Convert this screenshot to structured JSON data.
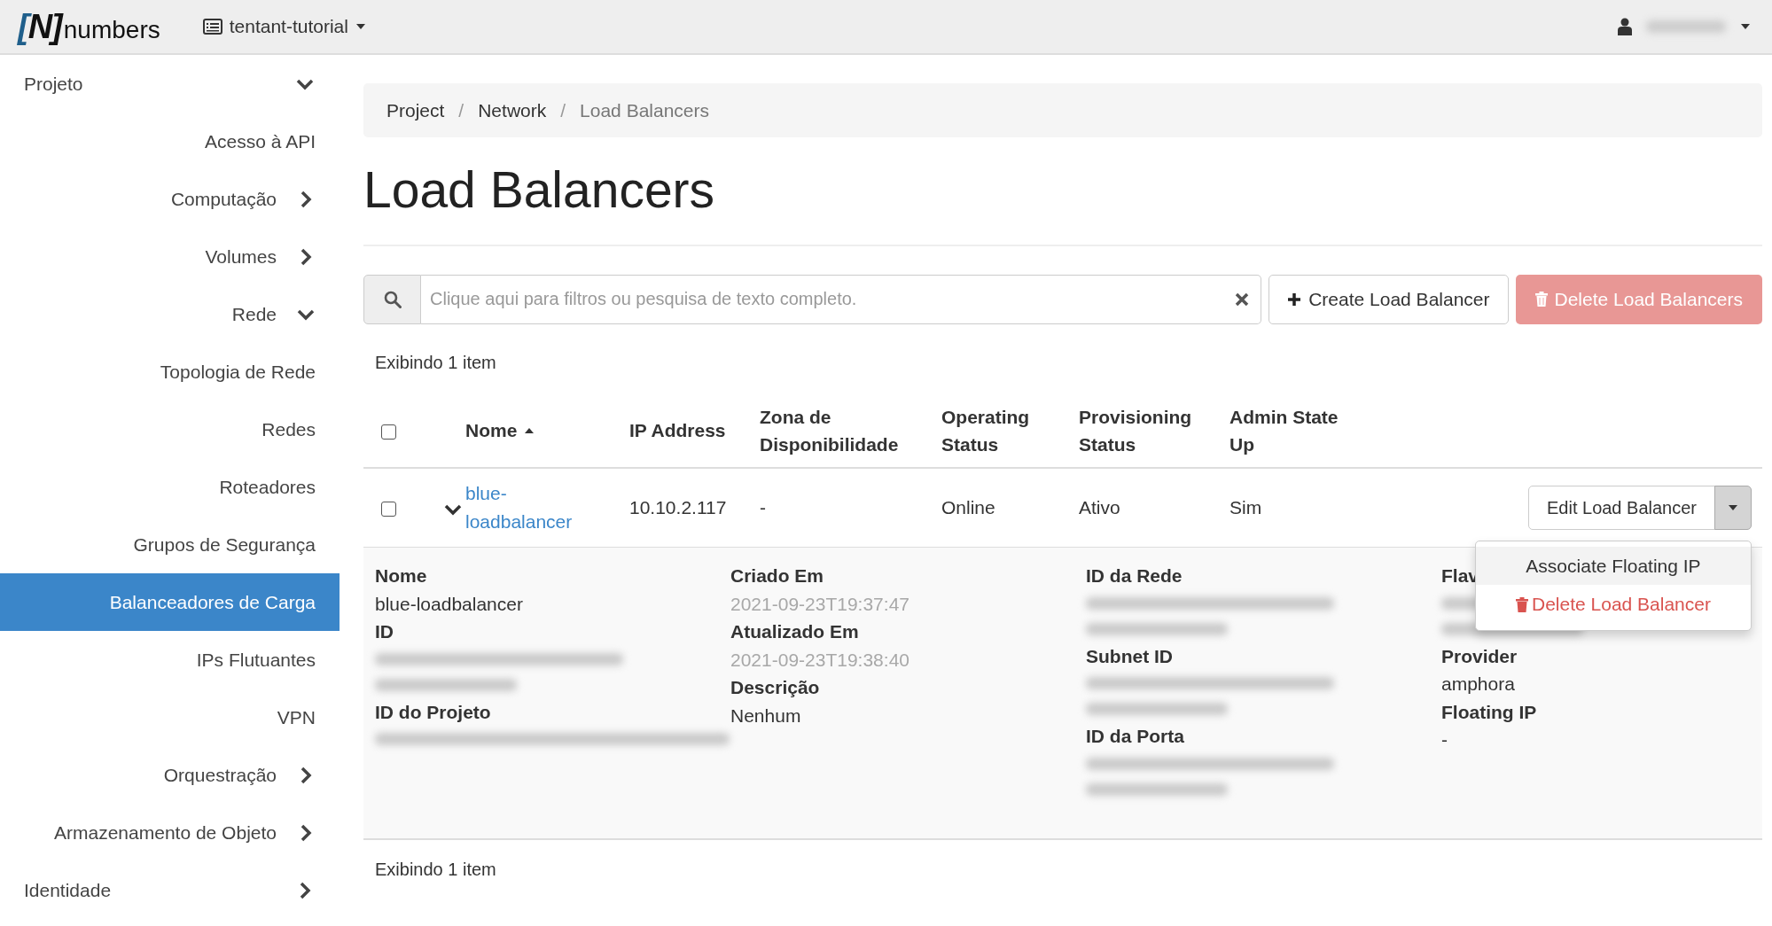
{
  "navbar": {
    "logo": {
      "mark": "[N]",
      "name": "numbers"
    },
    "project_menu": {
      "label": "tentant-tutorial"
    },
    "user_menu": {
      "name_redacted": true
    }
  },
  "sidebar": {
    "items": [
      {
        "kind": "group",
        "label": "Projeto",
        "expanded": true,
        "selected": false,
        "children": [
          {
            "kind": "link",
            "label": "Acesso à API",
            "selected": false
          },
          {
            "kind": "group",
            "label": "Computação",
            "expanded": false,
            "selected": false
          },
          {
            "kind": "group",
            "label": "Volumes",
            "expanded": false,
            "selected": false
          },
          {
            "kind": "group",
            "label": "Rede",
            "expanded": true,
            "selected": false,
            "children": [
              {
                "kind": "link",
                "label": "Topologia de Rede",
                "selected": false
              },
              {
                "kind": "link",
                "label": "Redes",
                "selected": false
              },
              {
                "kind": "link",
                "label": "Roteadores",
                "selected": false
              },
              {
                "kind": "link",
                "label": "Grupos de Segurança",
                "selected": false
              },
              {
                "kind": "link",
                "label": "Balanceadores de Carga",
                "selected": true
              },
              {
                "kind": "link",
                "label": "IPs Flutuantes",
                "selected": false
              },
              {
                "kind": "link",
                "label": "VPN",
                "selected": false
              }
            ]
          },
          {
            "kind": "group",
            "label": "Orquestração",
            "expanded": false,
            "selected": false
          },
          {
            "kind": "group",
            "label": "Armazenamento de Objeto",
            "expanded": false,
            "selected": false
          }
        ]
      },
      {
        "kind": "group",
        "label": "Identidade",
        "expanded": false,
        "selected": false
      }
    ]
  },
  "breadcrumb": {
    "items": [
      "Project",
      "Network",
      "Load Balancers"
    ],
    "separators": [
      "/",
      "/"
    ]
  },
  "page_title": "Load Balancers",
  "toolbar": {
    "search": {
      "placeholder": "Clique aqui para filtros ou pesquisa de texto completo."
    },
    "buttons": [
      {
        "kind": "create",
        "label": "Create Load Balancer",
        "disabled": false
      },
      {
        "kind": "delete",
        "label": "Delete Load Balancers",
        "disabled": true
      }
    ]
  },
  "table": {
    "count_top": "Exibindo 1 item",
    "select_all_checked": false,
    "columns": [
      {
        "label": "Nome",
        "sorted": true
      },
      {
        "label": "IP Address",
        "sorted": false
      },
      {
        "label": "Zona de Disponibilidade",
        "sorted": false
      },
      {
        "label": "Operating Status",
        "sorted": false
      },
      {
        "label": "Provisioning Status",
        "sorted": false
      },
      {
        "label": "Admin State Up",
        "sorted": false
      }
    ],
    "rows": [
      {
        "checked": false,
        "expanded": true,
        "cells": [
          "blue-loadbalancer",
          "10.10.2.117",
          "-",
          "Online",
          "Ativo",
          "Sim"
        ],
        "actions": {
          "primary": "Edit Load Balancer",
          "menu_open": true,
          "menu": [
            {
              "kind": "normal",
              "label": "Associate Floating IP",
              "selected": true
            },
            {
              "kind": "danger",
              "label": "Delete Load Balancer",
              "selected": false
            }
          ]
        },
        "details": [
          [
            {
              "label": "Nome",
              "value": "blue-loadbalancer"
            },
            {
              "label": "ID",
              "redacted": true,
              "wrapped": true
            },
            {
              "label": "ID do Projeto",
              "redacted": true,
              "wrapped": false
            }
          ],
          [
            {
              "label": "Criado Em",
              "value": "2021-09-23T19:37:47",
              "faded": true
            },
            {
              "label": "Atualizado Em",
              "value": "2021-09-23T19:38:40",
              "faded": true
            },
            {
              "label": "Descrição",
              "value": "Nenhum"
            }
          ],
          [
            {
              "label": "ID da Rede",
              "redacted": true,
              "wrapped": true
            },
            {
              "label": "Subnet ID",
              "redacted": true,
              "wrapped": true
            },
            {
              "label": "ID da Porta",
              "redacted": true,
              "wrapped": true
            }
          ],
          [
            {
              "label": "Flav",
              "redacted": true,
              "wrapped": true
            },
            {
              "label": "Provider",
              "value": "amphora"
            },
            {
              "label": "Floating IP",
              "value": "-"
            }
          ]
        ]
      }
    ],
    "count_bottom": "Exibindo 1 item"
  }
}
